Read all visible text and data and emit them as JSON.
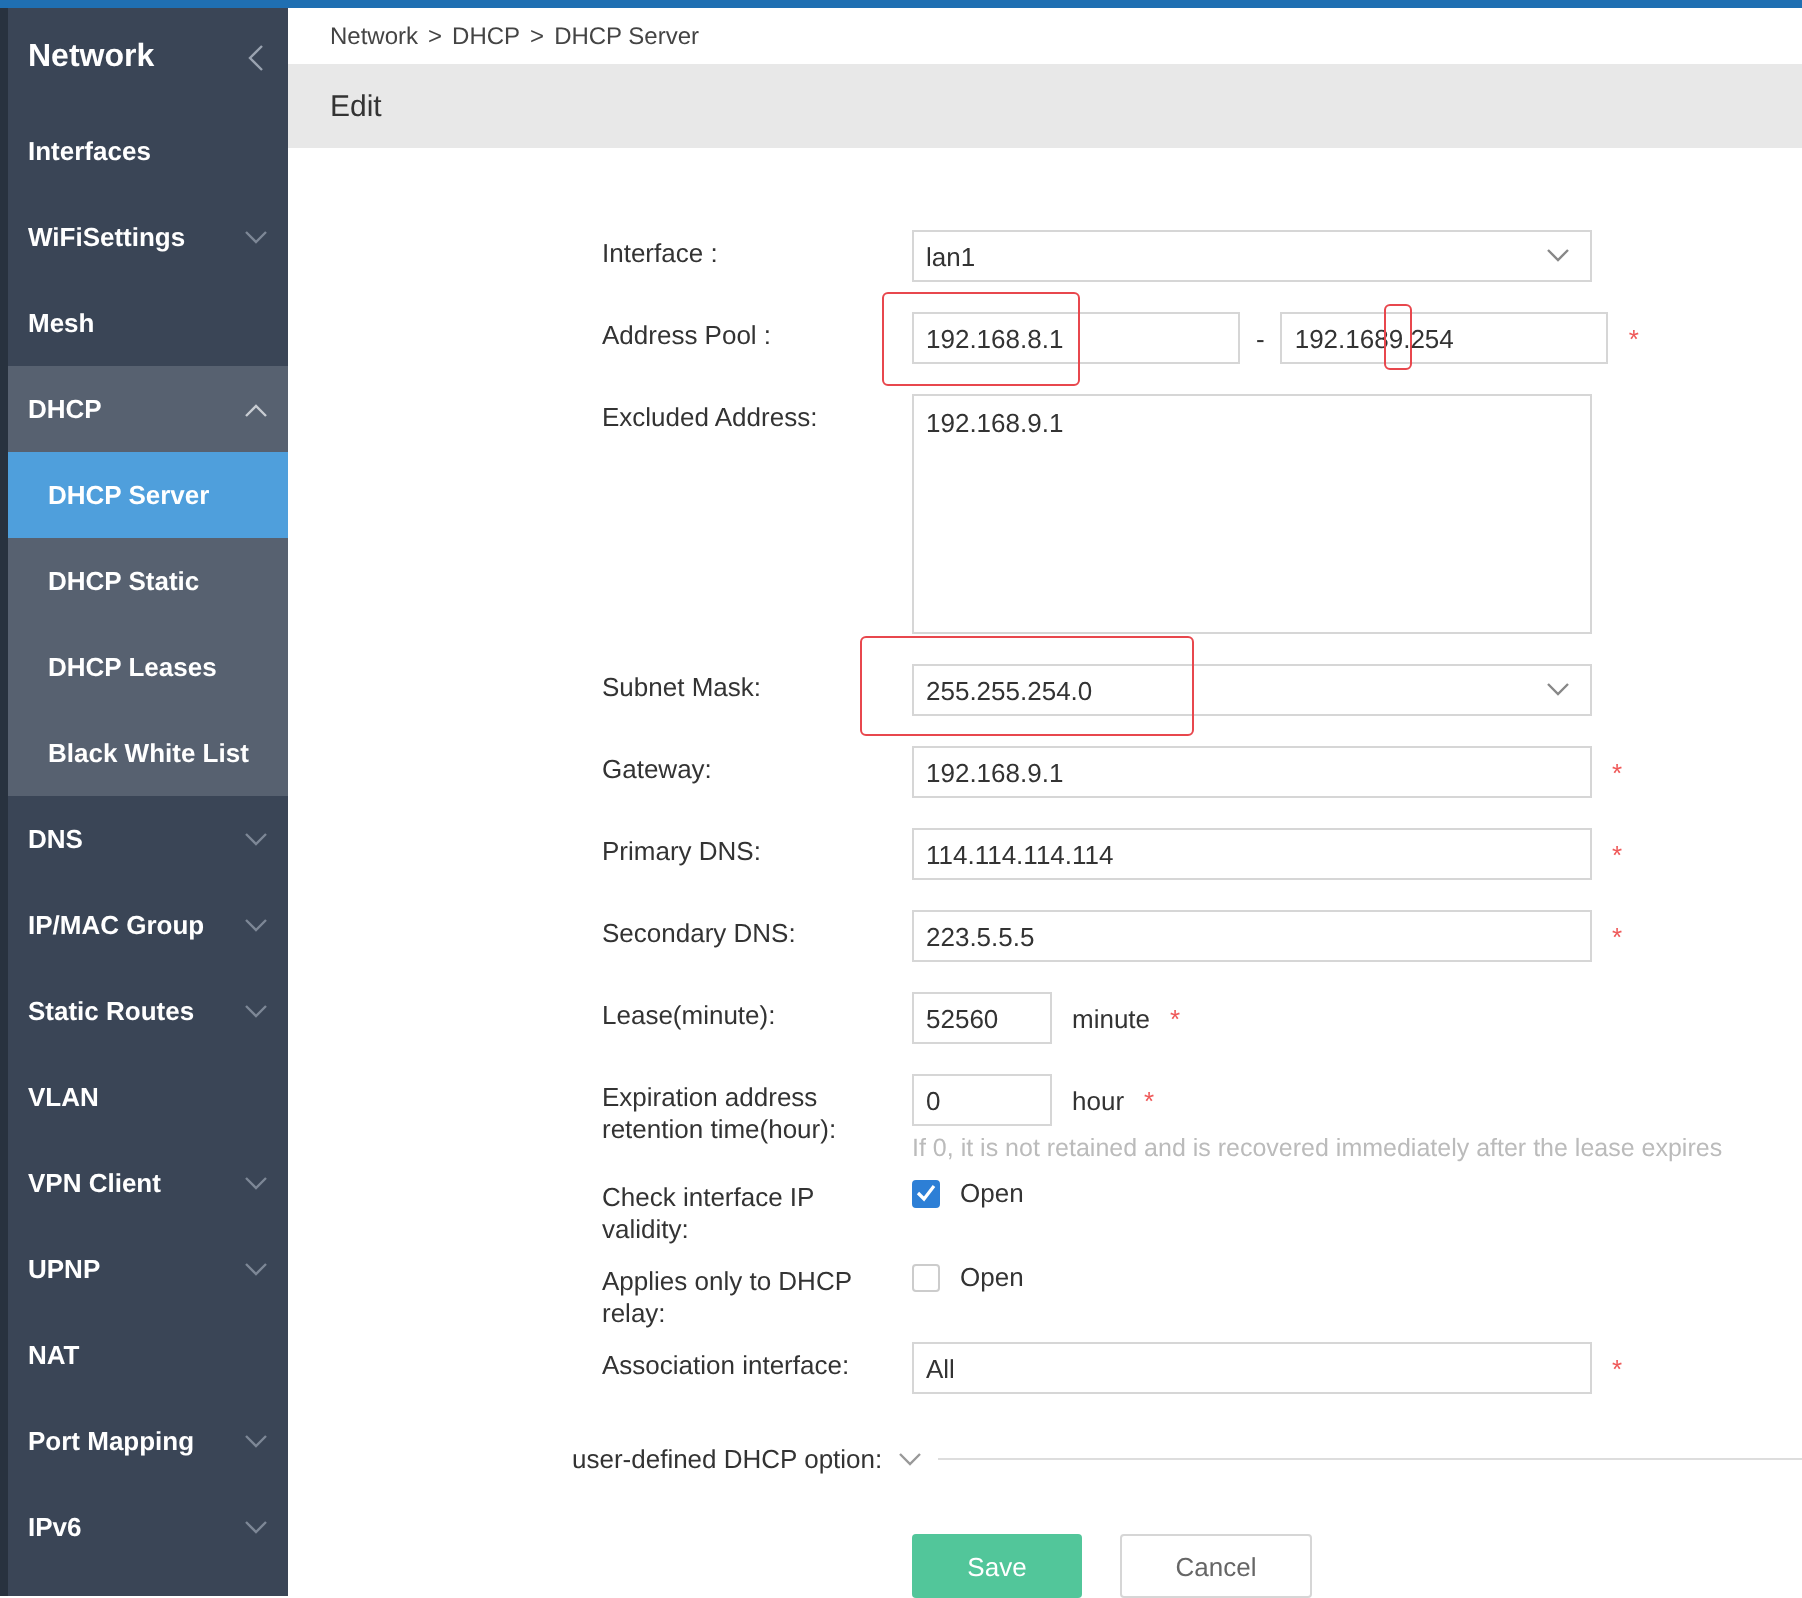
{
  "sidebar": {
    "title": "Network",
    "items": [
      {
        "label": "Interfaces",
        "expandable": false,
        "expanded": false
      },
      {
        "label": "WiFiSettings",
        "expandable": true,
        "expanded": false
      },
      {
        "label": "Mesh",
        "expandable": false,
        "expanded": false
      },
      {
        "label": "DHCP",
        "expandable": true,
        "expanded": true,
        "children": [
          {
            "label": "DHCP Server",
            "selected": true
          },
          {
            "label": "DHCP Static",
            "selected": false
          },
          {
            "label": "DHCP Leases",
            "selected": false
          },
          {
            "label": "Black White List",
            "selected": false
          }
        ]
      },
      {
        "label": "DNS",
        "expandable": true,
        "expanded": false
      },
      {
        "label": "IP/MAC Group",
        "expandable": true,
        "expanded": false
      },
      {
        "label": "Static Routes",
        "expandable": true,
        "expanded": false
      },
      {
        "label": "VLAN",
        "expandable": false,
        "expanded": false
      },
      {
        "label": "VPN Client",
        "expandable": true,
        "expanded": false
      },
      {
        "label": "UPNP",
        "expandable": true,
        "expanded": false
      },
      {
        "label": "NAT",
        "expandable": false,
        "expanded": false
      },
      {
        "label": "Port Mapping",
        "expandable": true,
        "expanded": false
      },
      {
        "label": "IPv6",
        "expandable": true,
        "expanded": false
      }
    ]
  },
  "breadcrumb": {
    "items": [
      "Network",
      "DHCP",
      "DHCP Server"
    ],
    "separator": ">"
  },
  "required_mark": "*",
  "page_title": "Edit",
  "fields": [
    {
      "kind": "select",
      "label": "Interface :",
      "value": "lan1"
    },
    {
      "kind": "range",
      "label": "Address Pool :",
      "separator": "-",
      "required": true,
      "start": {
        "value": "192.168.8.1",
        "marked": true
      },
      "end": {
        "segments": [
          {
            "text": "192.168"
          },
          {
            "text": "9.",
            "marked": true
          },
          {
            "text": "254"
          }
        ]
      }
    },
    {
      "kind": "textarea",
      "label": "Excluded Address:",
      "value": "192.168.9.1"
    },
    {
      "kind": "select",
      "label": "Subnet Mask:",
      "value": "255.255.254.0",
      "marked": true
    },
    {
      "kind": "text",
      "label": "Gateway:",
      "value": "192.168.9.1",
      "required": true
    },
    {
      "kind": "text",
      "label": "Primary DNS:",
      "value": "114.114.114.114",
      "required": true
    },
    {
      "kind": "text",
      "label": "Secondary DNS:",
      "value": "223.5.5.5",
      "required": true
    },
    {
      "kind": "unit",
      "label": "Lease(minute):",
      "value": "52560",
      "unit": "minute",
      "required": true
    },
    {
      "kind": "unit",
      "label": "Expiration address retention time(hour):",
      "value": "0",
      "unit": "hour",
      "required": true,
      "hint": "If 0, it is not retained and is recovered immediately after the lease expires"
    },
    {
      "kind": "checkbox",
      "label": "Check interface IP validity:",
      "option": "Open",
      "checked": true
    },
    {
      "kind": "checkbox",
      "label": "Applies only to DHCP relay:",
      "option": "Open",
      "checked": false
    },
    {
      "kind": "text",
      "label": "Association interface:",
      "value": "All",
      "required": true
    }
  ],
  "custom_option": {
    "label": "user-defined DHCP option:",
    "expanded": false
  },
  "buttons": [
    {
      "label": "Save",
      "kind": "primary"
    },
    {
      "label": "Cancel",
      "kind": "secondary"
    }
  ]
}
